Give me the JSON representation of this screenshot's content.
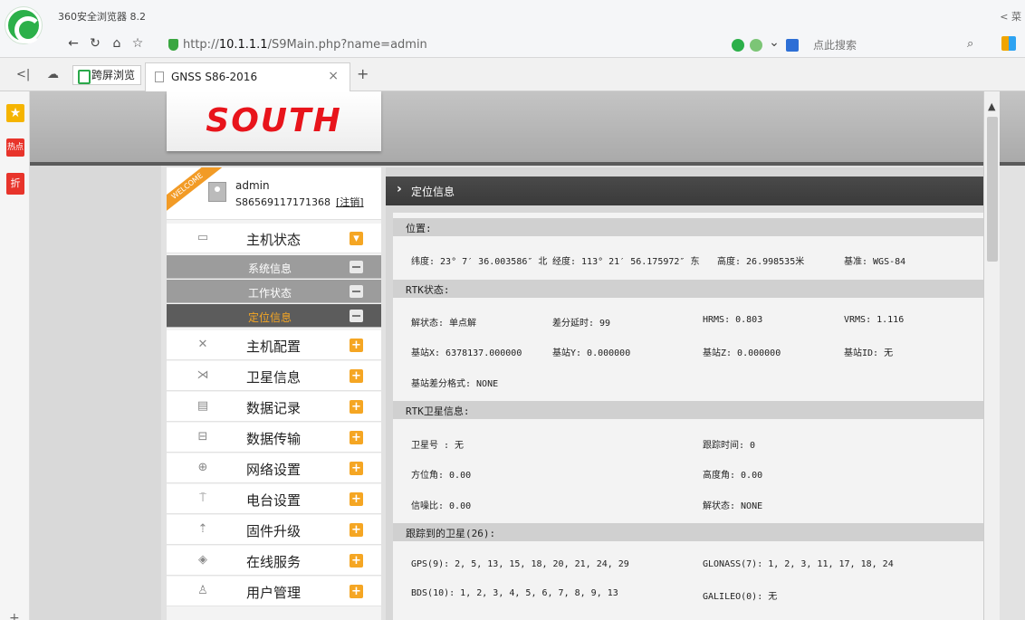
{
  "browser": {
    "title": "360安全浏览器 8.2",
    "title_right": "< 菜",
    "url_host": "10.1.1.1",
    "url_prefix": "http://",
    "url_path": "/S9Main.php?name=admin",
    "search_placeholder": "点此搜索",
    "cross_screen": "跨屏浏览",
    "tab_title": "GNSS S86-2016",
    "tab_close": "×",
    "tab_new": "+"
  },
  "sidebar_left": {
    "hot": "热点",
    "discount": "折",
    "add": "+"
  },
  "brand": {
    "logo": "SOUTH"
  },
  "user": {
    "welcome": "WELCOME",
    "name": "admin",
    "id": "S86569117171368",
    "logout": "[注销]"
  },
  "menu": [
    {
      "label": "主机状态",
      "icon": "monitor-icon",
      "expanded": true
    },
    {
      "label": "主机配置",
      "icon": "tools-icon"
    },
    {
      "label": "卫星信息",
      "icon": "satellite-icon"
    },
    {
      "label": "数据记录",
      "icon": "calendar-icon"
    },
    {
      "label": "数据传输",
      "icon": "network-icon"
    },
    {
      "label": "网络设置",
      "icon": "globe-icon"
    },
    {
      "label": "电台设置",
      "icon": "antenna-icon"
    },
    {
      "label": "固件升级",
      "icon": "upgrade-icon"
    },
    {
      "label": "在线服务",
      "icon": "cube-icon"
    },
    {
      "label": "用户管理",
      "icon": "users-icon"
    }
  ],
  "submenu": [
    {
      "label": "系统信息"
    },
    {
      "label": "工作状态"
    },
    {
      "label": "定位信息",
      "active": true
    }
  ],
  "panel": {
    "title": "定位信息",
    "sections": {
      "position": "位置:",
      "rtk_status": "RTK状态:",
      "rtk_sat": "RTK卫星信息:",
      "tracked": "跟踪到的卫星(26):"
    },
    "position": {
      "lat": "纬度: 23° 7′ 36.003586″ 北",
      "lon": "经度: 113° 21′ 56.175972″ 东",
      "height": "高度: 26.998535米",
      "datum": "基准: WGS-84"
    },
    "rtk": {
      "solution": "解状态: 单点解",
      "delay": "差分延时: 99",
      "hrms": "HRMS: 0.803",
      "vrms": "VRMS: 1.116",
      "bx": "基站X: 6378137.000000",
      "by": "基站Y: 0.000000",
      "bz": "基站Z: 0.000000",
      "bid": "基站ID: 无",
      "fmt": "基站差分格式: NONE"
    },
    "rtk_sat": {
      "sat_no": "卫星号 : 无",
      "track_time": "跟踪时间: 0",
      "azimuth": "方位角: 0.00",
      "elevation": "高度角: 0.00",
      "snr": "信噪比: 0.00",
      "sol_state": "解状态: NONE"
    },
    "tracked": {
      "gps": "GPS(9): 2, 5, 13, 15, 18, 20, 21, 24, 29",
      "glonass": "GLONASS(7): 1, 2, 3, 11, 17, 18, 24",
      "bds": "BDS(10): 1, 2, 3, 4, 5, 6, 7, 8, 9, 13",
      "galileo": "GALILEO(0): 无"
    }
  },
  "colors": {
    "accent_orange": "#f5a623",
    "brand_red": "#e8141b",
    "header_dark": "#3f3f3f"
  }
}
